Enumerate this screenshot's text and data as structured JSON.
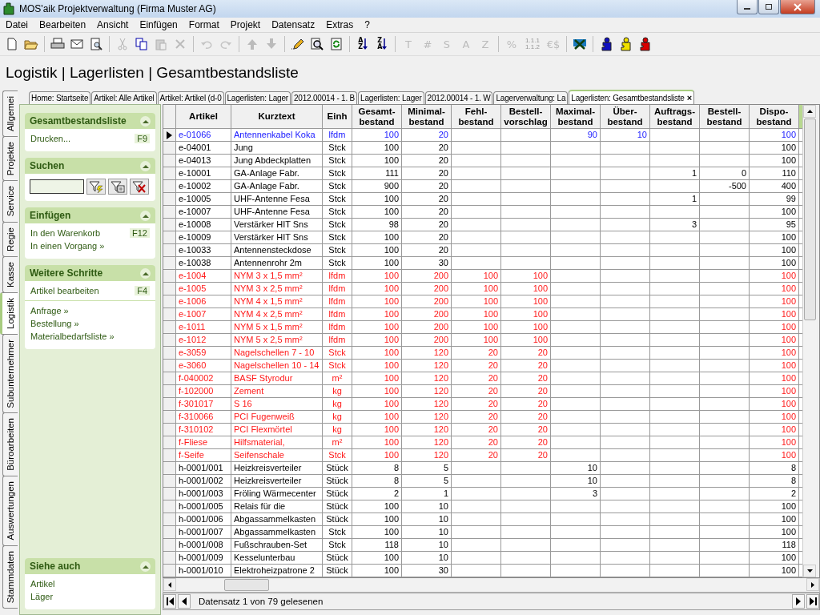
{
  "window": {
    "title": "MOS'aik Projektverwaltung (Firma Muster AG)"
  },
  "menu": [
    "Datei",
    "Bearbeiten",
    "Ansicht",
    "Einfügen",
    "Format",
    "Projekt",
    "Datensatz",
    "Extras",
    "?"
  ],
  "toolbar": [
    [
      {
        "kind": "new",
        "disabled": false
      },
      {
        "kind": "open",
        "disabled": false
      }
    ],
    [
      {
        "kind": "print",
        "disabled": false
      },
      {
        "kind": "mail",
        "disabled": false
      },
      {
        "kind": "preview",
        "disabled": false
      }
    ],
    [
      {
        "kind": "cut",
        "disabled": true
      },
      {
        "kind": "copy",
        "disabled": false
      },
      {
        "kind": "paste",
        "disabled": true
      },
      {
        "kind": "delete",
        "disabled": true
      }
    ],
    [
      {
        "kind": "undo",
        "disabled": true
      },
      {
        "kind": "redo",
        "disabled": true
      }
    ],
    [
      {
        "kind": "up",
        "disabled": true
      },
      {
        "kind": "down",
        "disabled": true
      }
    ],
    [
      {
        "kind": "edit",
        "disabled": false
      },
      {
        "kind": "find",
        "disabled": false
      },
      {
        "kind": "refresh",
        "disabled": false
      }
    ],
    [
      {
        "kind": "sort",
        "label": "AZ",
        "disabled": false
      },
      {
        "kind": "sort",
        "label": "ZA",
        "disabled": false
      }
    ],
    [
      {
        "kind": "glyph",
        "label": "T",
        "disabled": true
      },
      {
        "kind": "glyph",
        "label": "#",
        "disabled": true
      },
      {
        "kind": "glyph",
        "label": "S",
        "disabled": true
      },
      {
        "kind": "glyph",
        "label": "A",
        "disabled": true
      },
      {
        "kind": "glyph",
        "label": "Z",
        "disabled": true
      }
    ],
    [
      {
        "kind": "glyph",
        "label": "%",
        "disabled": true
      },
      {
        "kind": "glyph-small",
        "label": "1.1.1 1.1.2",
        "disabled": true
      },
      {
        "kind": "glyph",
        "label": "€$",
        "disabled": true
      }
    ],
    [
      {
        "kind": "tool",
        "disabled": false
      }
    ],
    [
      {
        "kind": "puzzle",
        "color": "#1010c0",
        "disabled": false
      },
      {
        "kind": "puzzle",
        "color": "#f0e000",
        "disabled": false
      },
      {
        "kind": "puzzle",
        "color": "#d80000",
        "disabled": false
      }
    ]
  ],
  "breadcrumb": "Logistik | Lagerlisten | Gesamtbestandsliste",
  "side_tabs": [
    {
      "label": "Allgemei",
      "selected": false
    },
    {
      "label": "Projekte",
      "selected": false
    },
    {
      "label": "Service",
      "selected": false
    },
    {
      "label": "Regie",
      "selected": false
    },
    {
      "label": "Kasse",
      "selected": false
    },
    {
      "label": "Logistik",
      "selected": true
    },
    {
      "label": "Subunternehmer",
      "selected": false
    },
    {
      "label": "Büroarbeiten",
      "selected": false
    },
    {
      "label": "Auswertungen",
      "selected": false
    },
    {
      "label": "Stammdaten",
      "selected": false
    }
  ],
  "panels": [
    {
      "kind": "links",
      "title": "Gesamtbestandsliste",
      "expanded": true,
      "groups": [
        [
          {
            "label": "Drucken...",
            "shortcut": "F9"
          }
        ]
      ]
    },
    {
      "kind": "search",
      "title": "Suchen",
      "expanded": true
    },
    {
      "kind": "links",
      "title": "Einfügen",
      "expanded": true,
      "groups": [
        [
          {
            "label": "In den Warenkorb",
            "shortcut": "F12"
          },
          {
            "label": "In einen Vorgang »"
          }
        ]
      ]
    },
    {
      "kind": "links",
      "title": "Weitere Schritte",
      "expanded": true,
      "groups": [
        [
          {
            "label": "Artikel bearbeiten",
            "shortcut": "F4"
          }
        ],
        [
          {
            "label": "Anfrage »"
          },
          {
            "label": "Bestellung »"
          },
          {
            "label": "Materialbedarfsliste »"
          }
        ]
      ]
    },
    {
      "kind": "footer",
      "title": "Siehe auch",
      "expanded": true,
      "groups": [
        [
          {
            "label": "Artikel"
          },
          {
            "label": "Läger"
          }
        ]
      ]
    }
  ],
  "doc_tabs": [
    {
      "label": "Home: Startseite",
      "selected": false
    },
    {
      "label": "Artikel: Alle Artikel",
      "selected": false
    },
    {
      "label": "Artikel: Artikel (d-0",
      "selected": false
    },
    {
      "label": "Lagerlisten: Lager",
      "selected": false
    },
    {
      "label": "2012.00014 - 1. B",
      "selected": false
    },
    {
      "label": "Lagerlisten: Lager",
      "selected": false
    },
    {
      "label": "2012.00014 - 1. W",
      "selected": false
    },
    {
      "label": "Lagerverwaltung: La",
      "selected": false
    },
    {
      "label": "Lagerlisten: Gesamtbestandsliste",
      "selected": true,
      "close": "×"
    }
  ],
  "table": {
    "columns": [
      "Artikel",
      "Kurztext",
      "Einh",
      "Gesamt-\nbestand",
      "Minimal-\nbestand",
      "Fehl-\nbestand",
      "Bestell-\nvorschlag",
      "Maximal-\nbestand",
      "Über-\nbestand",
      "Auftrags-\nbestand",
      "Bestell-\nbestand",
      "Dispo-\nbestand"
    ],
    "rows": [
      {
        "selected": true,
        "color": "#1a1aff",
        "cells": [
          "e-01066",
          "Antennenkabel Koka",
          "lfdm",
          "100",
          "20",
          null,
          null,
          "90",
          "10",
          null,
          null,
          "100"
        ]
      },
      {
        "selected": false,
        "color": "#000000",
        "cells": [
          "e-04001",
          "Jung",
          "Stck",
          "100",
          "20",
          null,
          null,
          null,
          null,
          null,
          null,
          "100"
        ]
      },
      {
        "selected": false,
        "color": "#000000",
        "cells": [
          "e-04013",
          "Jung Abdeckplatten",
          "Stck",
          "100",
          "20",
          null,
          null,
          null,
          null,
          null,
          null,
          "100"
        ]
      },
      {
        "selected": false,
        "color": "#000000",
        "cells": [
          "e-10001",
          "GA-Anlage Fabr.",
          "Stck",
          "111",
          "20",
          null,
          null,
          null,
          null,
          "1",
          "0",
          "110"
        ]
      },
      {
        "selected": false,
        "color": "#000000",
        "cells": [
          "e-10002",
          "GA-Anlage Fabr.",
          "Stck",
          "900",
          "20",
          null,
          null,
          null,
          null,
          null,
          "-500",
          "400"
        ]
      },
      {
        "selected": false,
        "color": "#000000",
        "cells": [
          "e-10005",
          "UHF-Antenne Fesa",
          "Stck",
          "100",
          "20",
          null,
          null,
          null,
          null,
          "1",
          null,
          "99"
        ]
      },
      {
        "selected": false,
        "color": "#000000",
        "cells": [
          "e-10007",
          "UHF-Antenne Fesa",
          "Stck",
          "100",
          "20",
          null,
          null,
          null,
          null,
          null,
          null,
          "100"
        ]
      },
      {
        "selected": false,
        "color": "#000000",
        "cells": [
          "e-10008",
          "Verstärker HIT Sns",
          "Stck",
          "98",
          "20",
          null,
          null,
          null,
          null,
          "3",
          null,
          "95"
        ]
      },
      {
        "selected": false,
        "color": "#000000",
        "cells": [
          "e-10009",
          "Verstärker HIT Sns",
          "Stck",
          "100",
          "20",
          null,
          null,
          null,
          null,
          null,
          null,
          "100"
        ]
      },
      {
        "selected": false,
        "color": "#000000",
        "cells": [
          "e-10033",
          "Antennensteckdose",
          "Stck",
          "100",
          "20",
          null,
          null,
          null,
          null,
          null,
          null,
          "100"
        ]
      },
      {
        "selected": false,
        "color": "#000000",
        "cells": [
          "e-10038",
          "Antennenrohr 2m",
          "Stck",
          "100",
          "30",
          null,
          null,
          null,
          null,
          null,
          null,
          "100"
        ]
      },
      {
        "selected": false,
        "color": "#ff1a1a",
        "cells": [
          "e-1004",
          "NYM 3 x 1,5 mm²",
          "lfdm",
          "100",
          "200",
          "100",
          "100",
          null,
          null,
          null,
          null,
          "100"
        ]
      },
      {
        "selected": false,
        "color": "#ff1a1a",
        "cells": [
          "e-1005",
          "NYM 3 x 2,5 mm²",
          "lfdm",
          "100",
          "200",
          "100",
          "100",
          null,
          null,
          null,
          null,
          "100"
        ]
      },
      {
        "selected": false,
        "color": "#ff1a1a",
        "cells": [
          "e-1006",
          "NYM 4 x 1,5 mm²",
          "lfdm",
          "100",
          "200",
          "100",
          "100",
          null,
          null,
          null,
          null,
          "100"
        ]
      },
      {
        "selected": false,
        "color": "#ff1a1a",
        "cells": [
          "e-1007",
          "NYM 4 x 2,5 mm²",
          "lfdm",
          "100",
          "200",
          "100",
          "100",
          null,
          null,
          null,
          null,
          "100"
        ]
      },
      {
        "selected": false,
        "color": "#ff1a1a",
        "cells": [
          "e-1011",
          "NYM 5 x 1,5 mm²",
          "lfdm",
          "100",
          "200",
          "100",
          "100",
          null,
          null,
          null,
          null,
          "100"
        ]
      },
      {
        "selected": false,
        "color": "#ff1a1a",
        "cells": [
          "e-1012",
          "NYM 5 x 2,5 mm²",
          "lfdm",
          "100",
          "200",
          "100",
          "100",
          null,
          null,
          null,
          null,
          "100"
        ]
      },
      {
        "selected": false,
        "color": "#ff1a1a",
        "cells": [
          "e-3059",
          "Nagelschellen 7 - 10",
          "Stck",
          "100",
          "120",
          "20",
          "20",
          null,
          null,
          null,
          null,
          "100"
        ]
      },
      {
        "selected": false,
        "color": "#ff1a1a",
        "cells": [
          "e-3060",
          "Nagelschellen 10 - 14",
          "Stck",
          "100",
          "120",
          "20",
          "20",
          null,
          null,
          null,
          null,
          "100"
        ]
      },
      {
        "selected": false,
        "color": "#ff1a1a",
        "cells": [
          "f-040002",
          "BASF Styrodur",
          "m²",
          "100",
          "120",
          "20",
          "20",
          null,
          null,
          null,
          null,
          "100"
        ]
      },
      {
        "selected": false,
        "color": "#ff1a1a",
        "cells": [
          "f-102000",
          "Zement",
          "kg",
          "100",
          "120",
          "20",
          "20",
          null,
          null,
          null,
          null,
          "100"
        ]
      },
      {
        "selected": false,
        "color": "#ff1a1a",
        "cells": [
          "f-301017",
          "S 16",
          "kg",
          "100",
          "120",
          "20",
          "20",
          null,
          null,
          null,
          null,
          "100"
        ]
      },
      {
        "selected": false,
        "color": "#ff1a1a",
        "cells": [
          "f-310066",
          "PCI Fugenweiß",
          "kg",
          "100",
          "120",
          "20",
          "20",
          null,
          null,
          null,
          null,
          "100"
        ]
      },
      {
        "selected": false,
        "color": "#ff1a1a",
        "cells": [
          "f-310102",
          "PCI Flexmörtel",
          "kg",
          "100",
          "120",
          "20",
          "20",
          null,
          null,
          null,
          null,
          "100"
        ]
      },
      {
        "selected": false,
        "color": "#ff1a1a",
        "cells": [
          "f-Fliese",
          "Hilfsmaterial,",
          "m²",
          "100",
          "120",
          "20",
          "20",
          null,
          null,
          null,
          null,
          "100"
        ]
      },
      {
        "selected": false,
        "color": "#ff1a1a",
        "cells": [
          "f-Seife",
          "Seifenschale",
          "Stck",
          "100",
          "120",
          "20",
          "20",
          null,
          null,
          null,
          null,
          "100"
        ]
      },
      {
        "selected": false,
        "color": "#000000",
        "cells": [
          "h-0001/001",
          "Heizkreisverteiler",
          "Stück",
          "8",
          "5",
          null,
          null,
          "10",
          null,
          null,
          null,
          "8"
        ]
      },
      {
        "selected": false,
        "color": "#000000",
        "cells": [
          "h-0001/002",
          "Heizkreisverteiler",
          "Stück",
          "8",
          "5",
          null,
          null,
          "10",
          null,
          null,
          null,
          "8"
        ]
      },
      {
        "selected": false,
        "color": "#000000",
        "cells": [
          "h-0001/003",
          "Fröling Wärmecenter",
          "Stück",
          "2",
          "1",
          null,
          null,
          "3",
          null,
          null,
          null,
          "2"
        ]
      },
      {
        "selected": false,
        "color": "#000000",
        "cells": [
          "h-0001/005",
          "Relais für die",
          "Stück",
          "100",
          "10",
          null,
          null,
          null,
          null,
          null,
          null,
          "100"
        ]
      },
      {
        "selected": false,
        "color": "#000000",
        "cells": [
          "h-0001/006",
          "Abgassammelkasten",
          "Stück",
          "100",
          "10",
          null,
          null,
          null,
          null,
          null,
          null,
          "100"
        ]
      },
      {
        "selected": false,
        "color": "#000000",
        "cells": [
          "h-0001/007",
          "Abgassammelkasten",
          "Stck",
          "100",
          "10",
          null,
          null,
          null,
          null,
          null,
          null,
          "100"
        ]
      },
      {
        "selected": false,
        "color": "#000000",
        "cells": [
          "h-0001/008",
          "Fußschrauben-Set",
          "Stck",
          "118",
          "10",
          null,
          null,
          null,
          null,
          null,
          null,
          "118"
        ]
      },
      {
        "selected": false,
        "color": "#000000",
        "cells": [
          "h-0001/009",
          "Kesselunterbau",
          "Stück",
          "100",
          "10",
          null,
          null,
          null,
          null,
          null,
          null,
          "100"
        ]
      },
      {
        "selected": false,
        "color": "#000000",
        "cells": [
          "h-0001/010",
          "Elektroheizpatrone 2",
          "Stück",
          "100",
          "30",
          null,
          null,
          null,
          null,
          null,
          null,
          "100"
        ]
      }
    ]
  },
  "status_bar": {
    "text": "Datensatz 1 von 79 gelesenen"
  }
}
